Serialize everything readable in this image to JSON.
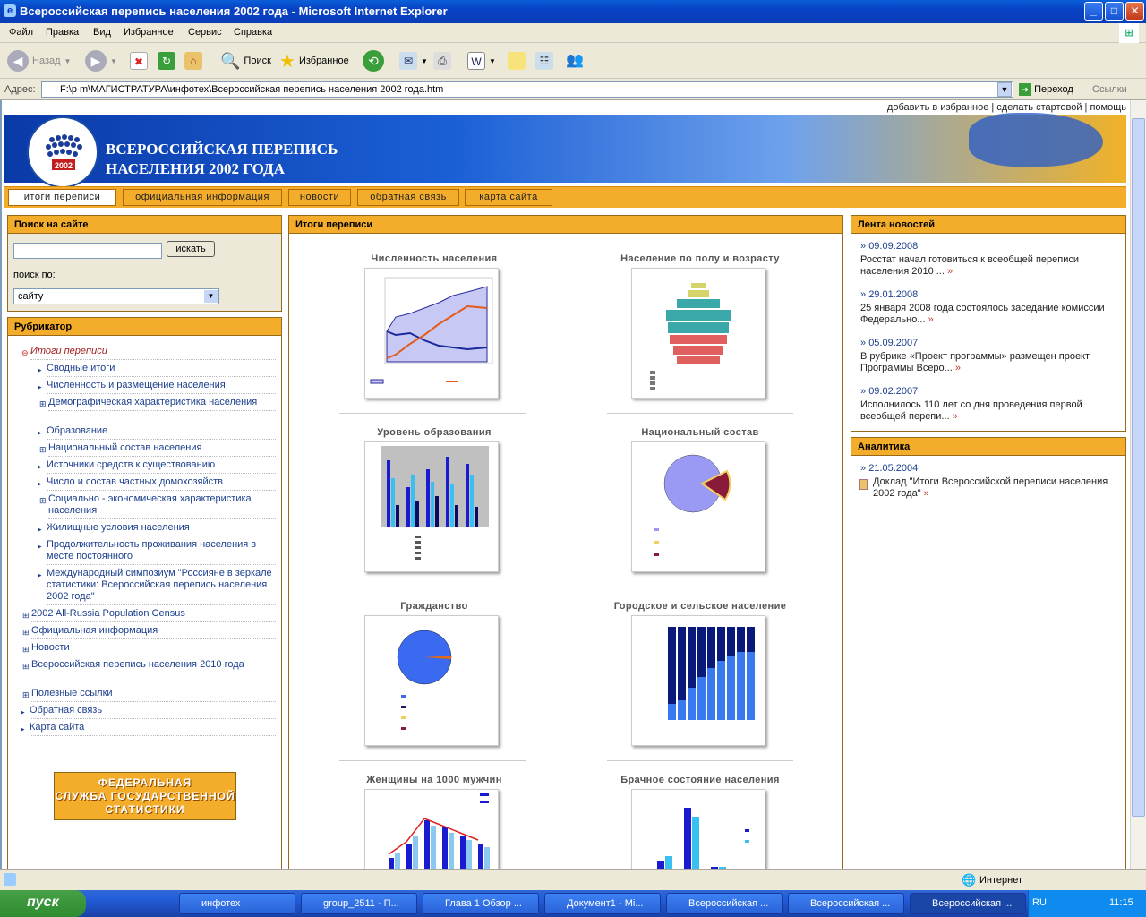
{
  "window": {
    "title": "Всероссийская перепись населения 2002 года - Microsoft Internet Explorer"
  },
  "menu": [
    "Файл",
    "Правка",
    "Вид",
    "Избранное",
    "Сервис",
    "Справка"
  ],
  "toolbar": {
    "back": "Назад",
    "search": "Поиск",
    "favorites": "Избранное"
  },
  "address": {
    "label": "Адрес:",
    "url": "F:\\p m\\МАГИСТРАТУРА\\инфотех\\Всероссийская перепись населения 2002 года.htm",
    "go": "Переход",
    "links": "Ссылки"
  },
  "toplinks": "добавить в избранное | сделать стартовой | помощь",
  "banner": {
    "line1": "ВСЕРОССИЙСКАЯ ПЕРЕПИСЬ",
    "line2": "НАСЕЛЕНИЯ 2002 ГОДА",
    "logo_year": "2002"
  },
  "nav": [
    "итоги переписи",
    "официальная информация",
    "новости",
    "обратная связь",
    "карта сайта"
  ],
  "search": {
    "title": "Поиск на сайте",
    "button": "искать",
    "label": "поиск по:",
    "selected": "сайту"
  },
  "rubricator": {
    "title": "Рубрикатор",
    "items": [
      "Итоги переписи",
      "Сводные итоги",
      "Численность и размещение населения",
      "Демографическая характеристика населения",
      "Образование",
      "Национальный состав населения",
      "Источники средств к существованию",
      "Число и состав частных домохозяйств",
      "Социально - экономическая характеристика населения",
      "Жилищные условия населения",
      "Продолжительность проживания населения в месте постоянного",
      "Международный симпозиум \"Россияне в зеркале статистики: Всероссийская перепись населения 2002 года\"",
      "2002 All-Russia Population Census",
      "Официальная информация",
      "Новости",
      "Всероссийская перепись населения 2010 года",
      "Полезные ссылки",
      "Обратная связь",
      "Карта сайта"
    ]
  },
  "fed": {
    "line1": "ФЕДЕРАЛЬНАЯ",
    "line2": "СЛУЖБА ГОСУДАРСТВЕННОЙ",
    "line3": "СТАТИСТИКИ"
  },
  "center": {
    "title": "Итоги переписи",
    "charts": [
      "Численность населения",
      "Население по полу и возрасту",
      "Уровень образования",
      "Национальный состав",
      "Гражданство",
      "Городское и сельское население",
      "Женщины на 1000 мужчин",
      "Брачное состояние населения"
    ]
  },
  "news": {
    "title": "Лента новостей",
    "items": [
      {
        "date": "09.09.2008",
        "text": "Росстат начал готовиться к всеобщей переписи населения 2010 ..."
      },
      {
        "date": "29.01.2008",
        "text": "25 января 2008 года состоялось заседание комиссии Федерально..."
      },
      {
        "date": "05.09.2007",
        "text": "В рубрике «Проект программы» размещен проект Программы Всеро..."
      },
      {
        "date": "09.02.2007",
        "text": "Исполнилось 110 лет со дня проведения первой всеобщей перепи..."
      }
    ]
  },
  "analytics": {
    "title": "Аналитика",
    "date": "21.05.2004",
    "text": "Доклад \"Итоги Всероссийской переписи населения 2002 года\""
  },
  "status": {
    "zone": "Интернет"
  },
  "taskbar": {
    "start": "пуск",
    "tasks": [
      "инфотех",
      "group_2511 - П...",
      "Глава 1 Обзор ...",
      "Документ1 - Mi...",
      "Всероссийская ...",
      "Всероссийская ...",
      "Всероссийская ..."
    ],
    "lang": "RU",
    "time": "11:15"
  },
  "colors": {
    "accent": "#f4ad2a",
    "link": "#1c3f8c",
    "banner": "#1b5fd6"
  }
}
